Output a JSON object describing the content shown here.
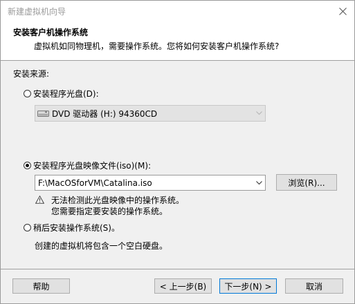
{
  "window": {
    "title": "新建虚拟机向导"
  },
  "header": {
    "title": "安装客户机操作系统",
    "subtitle": "虚拟机如同物理机，需要操作系统。您将如何安装客户机操作系统?"
  },
  "install_source": {
    "label": "安装来源:",
    "options": [
      {
        "label": "安装程序光盘(D):",
        "selected": false
      },
      {
        "label": "安装程序光盘映像文件(iso)(M):",
        "selected": true
      },
      {
        "label": "稍后安装操作系统(S)。",
        "selected": false
      }
    ],
    "disc_drive": {
      "value": "DVD 驱动器 (H:) 94360CD",
      "icon": "dvd-drive-icon",
      "enabled": false
    },
    "iso_path": {
      "value": "F:\\MacOSforVM\\Catalina.iso"
    },
    "browse_label": "浏览(R)...",
    "warning": {
      "icon": "warning-triangle-icon",
      "line1": "无法检测此光盘映像中的操作系统。",
      "line2": "您需要指定要安装的操作系统。"
    },
    "later_description": "创建的虚拟机将包含一个空白硬盘。"
  },
  "footer": {
    "help_label": "帮助",
    "back_label": "< 上一步(B)",
    "next_label": "下一步(N) >",
    "cancel_label": "取消"
  },
  "colors": {
    "title_text": "#9b9b9b",
    "dialog_bg": "#f0f0f0",
    "button_bg": "#e1e1e1",
    "button_border": "#adadad",
    "disabled_combo_bg": "#e3e3e3"
  }
}
